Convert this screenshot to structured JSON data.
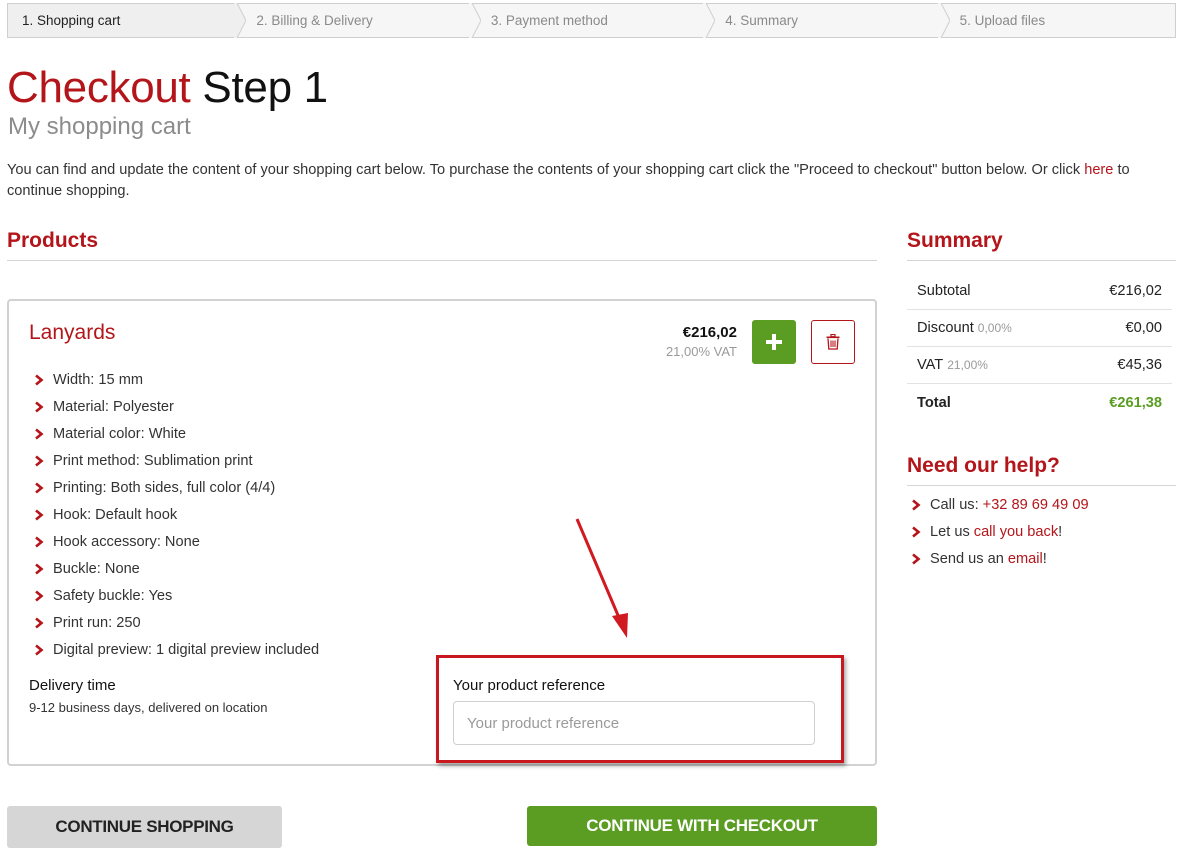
{
  "stepper": {
    "steps": [
      {
        "label": "1. Shopping cart",
        "active": true
      },
      {
        "label": "2. Billing & Delivery",
        "active": false
      },
      {
        "label": "3. Payment method",
        "active": false
      },
      {
        "label": "4. Summary",
        "active": false
      },
      {
        "label": "5. Upload files",
        "active": false
      }
    ]
  },
  "header": {
    "title_highlight": "Checkout",
    "title_rest": "Step 1",
    "subtitle": "My shopping cart",
    "intro_text": "You can find and update the content of your shopping cart below. To purchase the contents of your shopping cart click the \"Proceed to checkout\" button below. Or click",
    "intro_link": "here",
    "intro_tail": " to continue shopping."
  },
  "products": {
    "heading": "Products",
    "items": [
      {
        "name": "Lanyards",
        "price": "€216,02",
        "vat_note": "21,00% VAT",
        "add_icon": "plus-icon",
        "delete_icon": "trash-icon",
        "specs": [
          "Width: 15 mm",
          "Material: Polyester",
          "Material color: White",
          "Print method: Sublimation print",
          "Printing: Both sides, full color (4/4)",
          "Hook: Default hook",
          "Hook accessory: None",
          "Buckle: None",
          "Safety buckle: Yes",
          "Print run: 250",
          "Digital preview: 1 digital preview included"
        ],
        "delivery_label": "Delivery time",
        "delivery_value": "9-12 business days, delivered on location",
        "reference_label": "Your product reference",
        "reference_placeholder": "Your product reference",
        "reference_value": ""
      }
    ]
  },
  "summary": {
    "heading": "Summary",
    "rows": [
      {
        "label": "Subtotal",
        "pct": "",
        "value": "€216,02"
      },
      {
        "label": "Discount",
        "pct": "0,00%",
        "value": "€0,00"
      },
      {
        "label": "VAT",
        "pct": "21,00%",
        "value": "€45,36"
      },
      {
        "label": "Total",
        "pct": "",
        "value": "€261,38"
      }
    ]
  },
  "help": {
    "heading": "Need our help?",
    "items": [
      {
        "prefix": "Call us:",
        "link": "+32 89 69 49 09",
        "suffix": ""
      },
      {
        "prefix": "Let us",
        "link": "call you back",
        "suffix": "!"
      },
      {
        "prefix": "Send us an",
        "link": "email",
        "suffix": "!"
      }
    ]
  },
  "buttons": {
    "continue_shopping": "CONTINUE SHOPPING",
    "continue_checkout": "CONTINUE WITH CHECKOUT"
  },
  "colors": {
    "brand_red": "#b3151a",
    "accent_green": "#5a9d22",
    "annotation_red": "#c8171e"
  }
}
